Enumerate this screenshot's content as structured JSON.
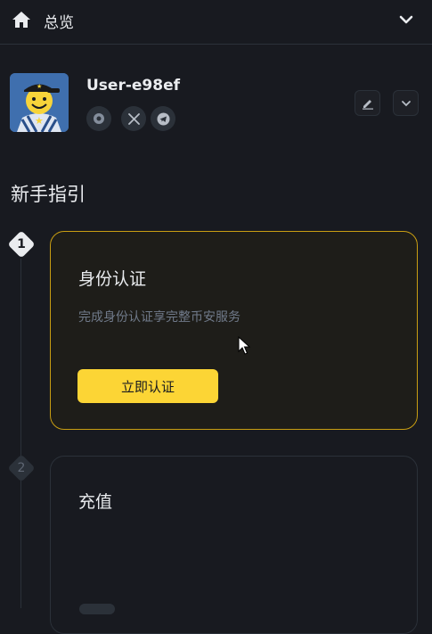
{
  "header": {
    "title": "总览",
    "icons": [
      "home-icon",
      "chevron-down-icon"
    ]
  },
  "profile": {
    "username": "User-e98ef",
    "social_icons": [
      "verified-badge-icon",
      "x-twitter-icon",
      "telegram-icon"
    ],
    "action_icons": [
      "edit-icon",
      "chevron-down-icon"
    ]
  },
  "guide": {
    "title": "新手指引",
    "steps": [
      {
        "number": "1",
        "title": "身份认证",
        "description": "完成身份认证享完整币安服务",
        "button_label": "立即认证"
      },
      {
        "number": "2",
        "title": "充值"
      }
    ]
  },
  "colors": {
    "background": "#181a20",
    "accent": "#fcd535",
    "active_border": "#c99e12",
    "muted_text": "#707a8a"
  }
}
